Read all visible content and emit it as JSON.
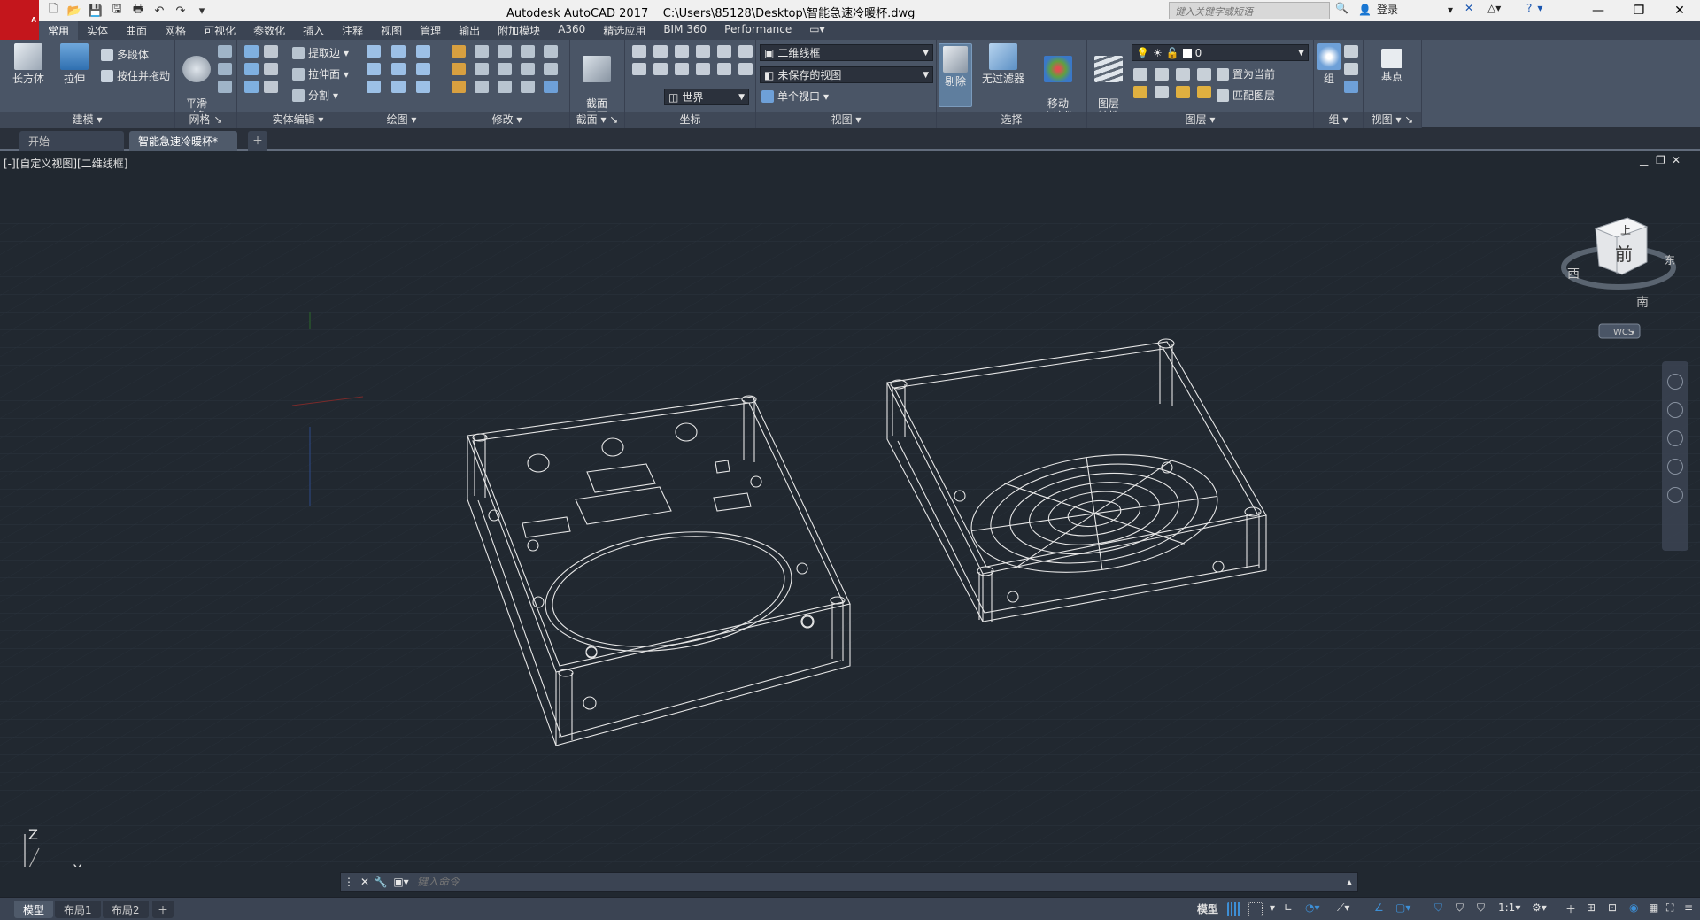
{
  "app": {
    "logo_letter": "A",
    "title": "Autodesk AutoCAD 2017",
    "file_path": "C:\\Users\\85128\\Desktop\\智能急速冷暖杯.dwg"
  },
  "titlebar": {
    "search_placeholder": "键入关键字或短语",
    "login_label": "登录",
    "help_label": "?"
  },
  "ribbon_tabs": [
    "常用",
    "实体",
    "曲面",
    "网格",
    "可视化",
    "参数化",
    "插入",
    "注释",
    "视图",
    "管理",
    "输出",
    "附加模块",
    "A360",
    "精选应用",
    "BIM 360",
    "Performance"
  ],
  "panels": {
    "modeling": {
      "title": "建模",
      "box_label": "长方体",
      "extrude_label": "拉伸",
      "polysolid_label": "多段体",
      "presspull_label": "按住并拖动"
    },
    "mesh": {
      "title": "网格",
      "smooth_label": "平滑\n对象"
    },
    "solid_edit": {
      "title": "实体编辑",
      "extract_edges_label": "提取边",
      "extrude_faces_label": "拉伸面",
      "separate_label": "分割"
    },
    "draw": {
      "title": "绘图"
    },
    "modify": {
      "title": "修改"
    },
    "section": {
      "title": "截面",
      "plane_label": "截面\n平面"
    },
    "coordinates": {
      "title": "坐标",
      "world_label": "世界"
    },
    "view": {
      "title": "视图",
      "visual_style": "二维线框",
      "saved_view": "未保存的视图",
      "viewport": "单个视口"
    },
    "selection": {
      "title": "选择",
      "cull_label": "剔除",
      "no_filter_label": "无过滤器",
      "gizmo_label": "移动\n小控件"
    },
    "layers": {
      "title": "图层",
      "properties_label": "图层\n特性",
      "current_layer": "0",
      "set_current_label": "置为当前",
      "match_layer_label": "匹配图层"
    },
    "groups": {
      "title": "组",
      "group_label": "组"
    },
    "view2": {
      "title": "视图",
      "base_point_label": "基点"
    }
  },
  "doc_tabs": [
    {
      "label": "开始",
      "active": false
    },
    {
      "label": "智能急速冷暖杯*",
      "active": true
    }
  ],
  "viewport": {
    "label": "[-][自定义视图][二维线框]",
    "viewcube": {
      "top": "上",
      "front": "前",
      "west": "西",
      "south": "南",
      "east": "东",
      "wcs": "WCS"
    },
    "ucs": {
      "z": "Z",
      "x": "X"
    }
  },
  "command_line": {
    "placeholder": "键入命令"
  },
  "layout_tabs": [
    "模型",
    "布局1",
    "布局2"
  ],
  "status": {
    "model_label": "模型",
    "scale": "1:1"
  },
  "colors": {
    "ribbon": "#4a5566",
    "canvas": "#212830",
    "logo": "#c4161c",
    "accent": "#3d8fd6"
  }
}
